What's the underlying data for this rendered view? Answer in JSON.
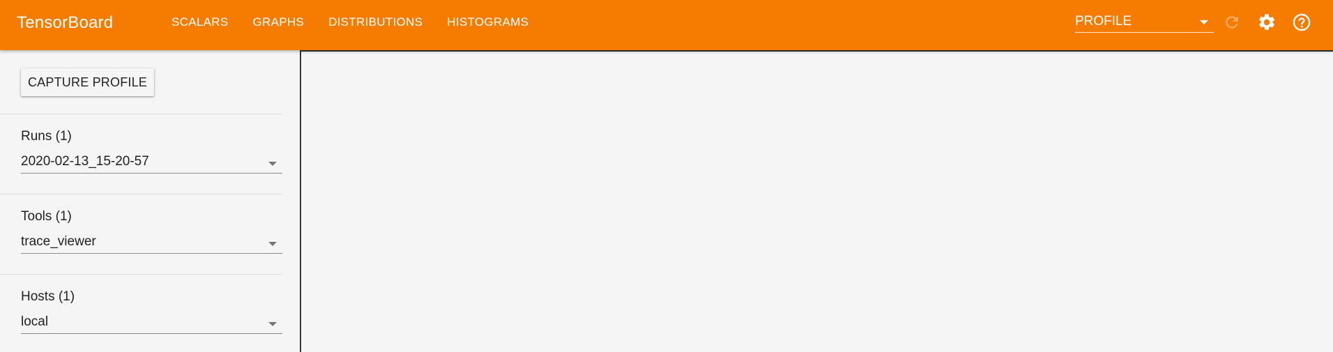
{
  "header": {
    "title": "TensorBoard",
    "nav": [
      "SCALARS",
      "GRAPHS",
      "DISTRIBUTIONS",
      "HISTOGRAMS"
    ],
    "plugin_select": {
      "value": "PROFILE"
    },
    "icons": [
      "refresh-icon",
      "settings-icon",
      "help-icon"
    ],
    "accent_color": "#f57c00"
  },
  "sidebar": {
    "capture_button": "CAPTURE PROFILE",
    "runs": {
      "label": "Runs (1)",
      "value": "2020-02-13_15-20-57"
    },
    "tools": {
      "label": "Tools (1)",
      "value": "trace_viewer"
    },
    "hosts": {
      "label": "Hosts (1)",
      "value": "local"
    }
  }
}
